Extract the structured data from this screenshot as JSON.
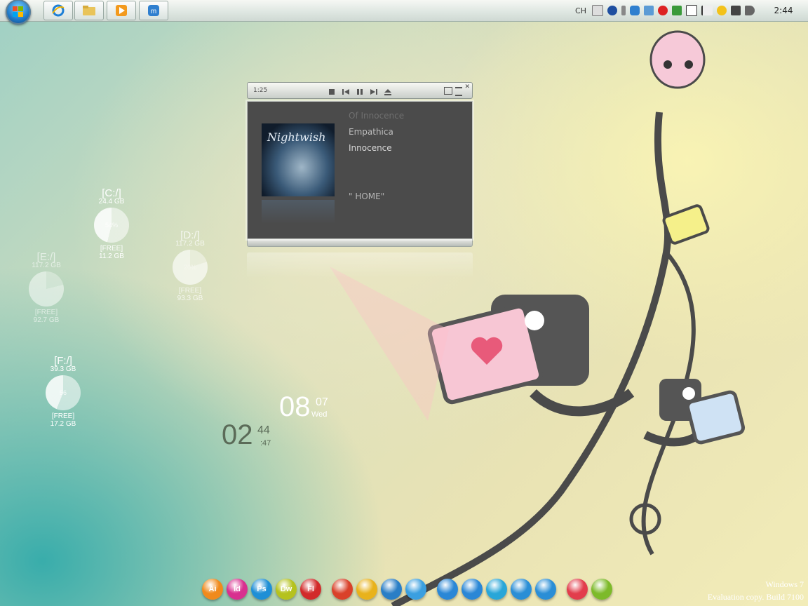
{
  "taskbar": {
    "pinned": [
      {
        "name": "Internet Explorer",
        "icon": "ie-icon"
      },
      {
        "name": "Windows Explorer",
        "icon": "folder-icon"
      },
      {
        "name": "Media Player",
        "icon": "media-player-icon"
      },
      {
        "name": "Maxthon",
        "icon": "maxthon-icon"
      }
    ],
    "tray": {
      "language": "CH",
      "clock": "2:44",
      "icons": [
        "keyboard-icon",
        "help-icon",
        "arrow-icon",
        "maxthon-icon",
        "network-icon",
        "alert-icon",
        "shield-check-icon",
        "window-icon",
        "flag-icon",
        "qq-icon",
        "monitor-icon",
        "speaker-icon"
      ]
    },
    "accent": "#1f79c7"
  },
  "drives": [
    {
      "name": "[C:/]",
      "total": "24.4 GB",
      "percent": "54%",
      "free_label": "[FREE]",
      "free": "11.2 GB",
      "used_fraction": 0.54
    },
    {
      "name": "[D:/]",
      "total": "117.2 GB",
      "percent": "20%",
      "free_label": "[FREE]",
      "free": "93.3 GB",
      "used_fraction": 0.2
    },
    {
      "name": "[E:/]",
      "total": "117.2 GB",
      "percent": "",
      "free_label": "[FREE]",
      "free": "92.7 GB",
      "used_fraction": 0.21
    },
    {
      "name": "[F:/]",
      "total": "39.3 GB",
      "percent": "56",
      "free_label": "[FREE]",
      "free": "17.2 GB",
      "used_fraction": 0.56
    }
  ],
  "clock_gadget": {
    "date_big": "08",
    "date_month": "07",
    "date_day": "Wed",
    "hour": "02",
    "minute": "44",
    "second": ":47"
  },
  "player": {
    "time": "1:25",
    "album_art_text": "Nightwish",
    "tracks": {
      "prev": "Of Innocence",
      "artist": "Empathica",
      "current": "Innocence"
    },
    "album": "\"  HOME\""
  },
  "dock": {
    "groups": [
      [
        {
          "name": "illustrator",
          "label": "Ai",
          "color": "#f08a1c"
        },
        {
          "name": "indesign",
          "label": "Id",
          "color": "#d8308f"
        },
        {
          "name": "photoshop",
          "label": "Ps",
          "color": "#1f8fd6"
        },
        {
          "name": "dreamweaver",
          "label": "Dw",
          "color": "#b5c21e"
        },
        {
          "name": "flash",
          "label": "Fl",
          "color": "#d22a2a"
        }
      ],
      [
        {
          "name": "firefox",
          "label": "",
          "color": "#d9412a"
        },
        {
          "name": "chrome",
          "label": "",
          "color": "#e8b21c"
        },
        {
          "name": "browser",
          "label": "",
          "color": "#2a7ec6"
        },
        {
          "name": "refresh",
          "label": "",
          "color": "#3a9fe0"
        }
      ],
      [
        {
          "name": "mail",
          "label": "",
          "color": "#2a87d6"
        },
        {
          "name": "write",
          "label": "",
          "color": "#2a87d6"
        },
        {
          "name": "media",
          "label": "",
          "color": "#29a6d8"
        },
        {
          "name": "music-1",
          "label": "",
          "color": "#2a8ed6"
        },
        {
          "name": "music-2",
          "label": "",
          "color": "#2a8ed6"
        }
      ],
      [
        {
          "name": "favorite",
          "label": "",
          "color": "#e23d4c"
        },
        {
          "name": "settings",
          "label": "",
          "color": "#7dba2a"
        }
      ]
    ]
  },
  "watermark": {
    "line1": "Windows 7",
    "line2": "Evaluation copy. Build 7100"
  }
}
